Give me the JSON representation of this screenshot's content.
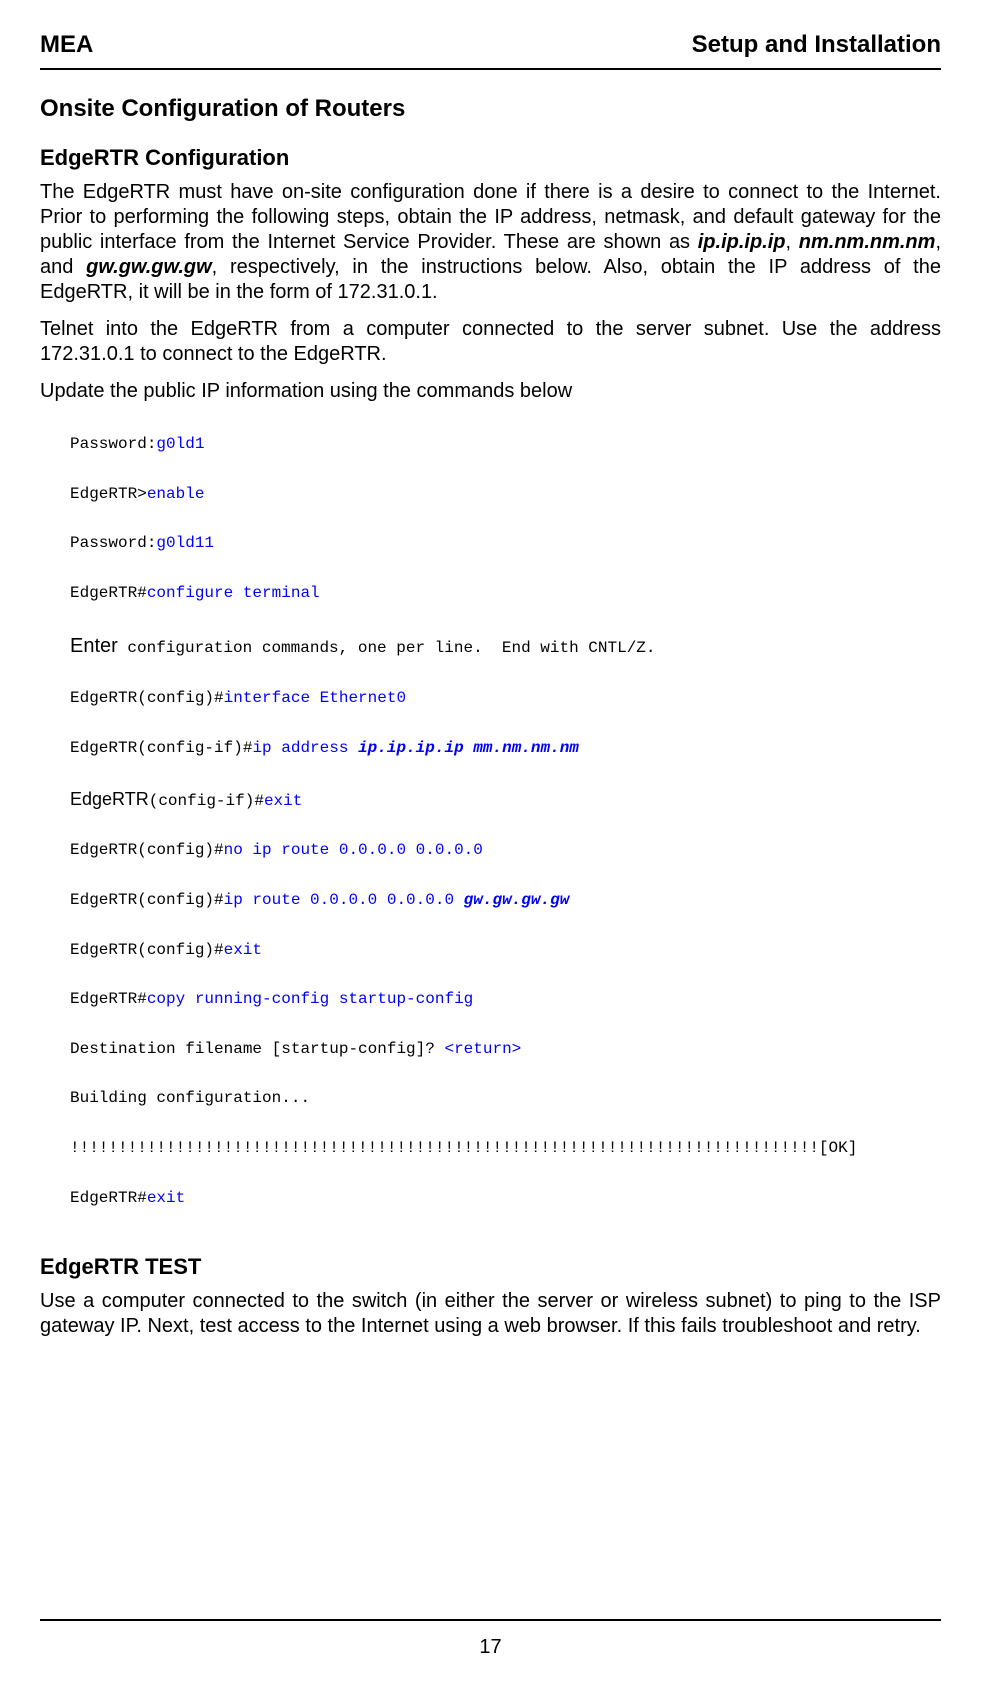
{
  "header": {
    "left": "MEA",
    "right": "Setup and Installation"
  },
  "title": "Onsite Configuration of Routers",
  "section1": {
    "heading": "EdgeRTR Configuration",
    "p1_a": "The EdgeRTR must have on-site configuration done if there is a desire to connect to the Internet.  Prior to performing the following steps, obtain the IP address, netmask, and default gateway for the public interface from the Internet Service Provider.  These are shown as ",
    "p1_ip": "ip.ip.ip.ip",
    "p1_sep1": ", ",
    "p1_nm": "nm.nm.nm.nm",
    "p1_sep2": ", and ",
    "p1_gw": "gw.gw.gw.gw",
    "p1_b": ", respectively, in the instructions below.  Also, obtain the IP address of the EdgeRTR, it will be in the form of 172.31.0.1.",
    "p2": "Telnet into the EdgeRTR from a computer connected to the server subnet. Use the address 172.31.0.1 to connect to the EdgeRTR.",
    "p3": "Update the public IP information using the commands below"
  },
  "code": {
    "l1_a": "Password:",
    "l1_b": "g0ld1",
    "l2_a": "EdgeRTR>",
    "l2_b": "enable",
    "l3_a": "Password:",
    "l3_b": "g0ld11",
    "l4_a": "EdgeRTR#",
    "l4_b": "configure terminal",
    "l5_a": "Enter",
    "l5_b": " configuration commands, one per line.  End with CNTL/Z.",
    "l6_a": "EdgeRTR(config)#",
    "l6_b": "interface Ethernet0",
    "l7_a": "EdgeRTR(config-if)#",
    "l7_b": "ip address ",
    "l7_c": "ip.ip.ip.ip mm.nm.nm.nm",
    "l8_a": "EdgeRTR",
    "l8_b": "(config-if)#",
    "l8_c": "exit",
    "l9_a": "EdgeRTR(config)#",
    "l9_b": "no ip route 0.0.0.0 0.0.0.0",
    "l10_a": "EdgeRTR(config)#",
    "l10_b": "ip route 0.0.0.0 0.0.0.0 ",
    "l10_c": "gw.gw.gw.gw",
    "l11_a": "EdgeRTR(config)#",
    "l11_b": "exit",
    "l12_a": "EdgeRTR#",
    "l12_b": "copy running-config startup-config",
    "l13_a": "Destination filename [startup-config]? ",
    "l13_b": "<return>",
    "l14": "Building configuration...",
    "l15": "!!!!!!!!!!!!!!!!!!!!!!!!!!!!!!!!!!!!!!!!!!!!!!!!!!!!!!!!!!!!!!!!!!!!!!!!!!!!!![OK]",
    "l16_a": "EdgeRTR#",
    "l16_b": "exit"
  },
  "section2": {
    "heading": "EdgeRTR TEST",
    "p1": "Use a computer connected to the switch (in either the server or wireless subnet) to ping to the ISP gateway IP.  Next, test access to the Internet using a web browser.  If this fails troubleshoot and retry."
  },
  "pageNumber": "17"
}
